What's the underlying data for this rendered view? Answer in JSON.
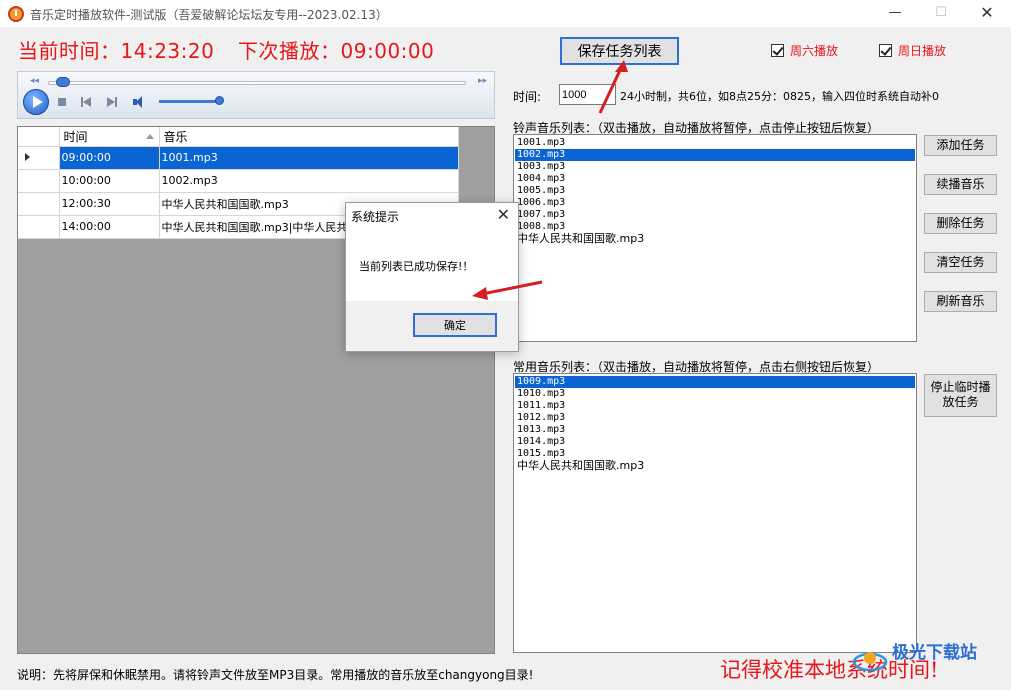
{
  "window": {
    "title": "音乐定时播放软件-测试版（吾爱破解论坛坛友专用--2023.02.13）",
    "minimize_symbol": "—",
    "maximize_symbol": "☐",
    "close_symbol": "✕"
  },
  "clock": {
    "current_label": "当前时间：",
    "current_time": "14:23:20",
    "next_label": "下次播放：",
    "next_time": "09:00:00"
  },
  "toolbar": {
    "save_label": "保存任务列表",
    "saturday_label": "周六播放",
    "saturday_checked": true,
    "sunday_label": "周日播放",
    "sunday_checked": true
  },
  "player": {
    "seek_progress": 0.02,
    "volume_level": 0.9
  },
  "schedule": {
    "columns": [
      "时间",
      "音乐"
    ],
    "selected_index": 0,
    "rows": [
      {
        "time": "09:00:00",
        "music": "1001.mp3"
      },
      {
        "time": "10:00:00",
        "music": "1002.mp3"
      },
      {
        "time": "12:00:30",
        "music": "中华人民共和国国歌.mp3"
      },
      {
        "time": "14:00:00",
        "music": "中华人民共和国国歌.mp3|中华人民共和国国歌.mp3"
      }
    ]
  },
  "time_field": {
    "label": "时间:",
    "value": "1000",
    "hint": "24小时制，共6位，如8点25分：0825，输入四位时系统自动补0"
  },
  "ring_list": {
    "label": "铃声音乐列表：（双击播放，自动播放将暂停，点击停止按钮后恢复）",
    "selected_index": 1,
    "items": [
      "1001.mp3",
      "1002.mp3",
      "1003.mp3",
      "1004.mp3",
      "1005.mp3",
      "1006.mp3",
      "1007.mp3",
      "1008.mp3",
      "中华人民共和国国歌.mp3"
    ]
  },
  "common_list": {
    "label": "常用音乐列表：（双击播放，自动播放将暂停，点击右侧按钮后恢复）",
    "selected_index": 0,
    "items": [
      "1009.mp3",
      "1010.mp3",
      "1011.mp3",
      "1012.mp3",
      "1013.mp3",
      "1014.mp3",
      "1015.mp3",
      "中华人民共和国国歌.mp3"
    ]
  },
  "side_buttons": {
    "add": "添加任务",
    "resume": "续播音乐",
    "delete": "删除任务",
    "clear": "清空任务",
    "refresh": "刷新音乐",
    "stop_temp_line1": "停止临时播",
    "stop_temp_line2": "放任务"
  },
  "footer": {
    "note": "说明：先将屏保和休眠禁用。请将铃声文件放至MP3目录。常用播放的音乐放至changyong目录!",
    "reminder": "记得校准本地系统时间!"
  },
  "watermark": {
    "text": "极光下载站"
  },
  "dialog": {
    "title": "系统提示",
    "close_symbol": "✕",
    "message": "当前列表已成功保存!！",
    "ok_label": "确定"
  },
  "colors": {
    "clock_red": "#e8161b",
    "selection_blue": "#0a64d2",
    "annotation_arrow": "#d42020",
    "focus_border": "#2f6fd8"
  }
}
